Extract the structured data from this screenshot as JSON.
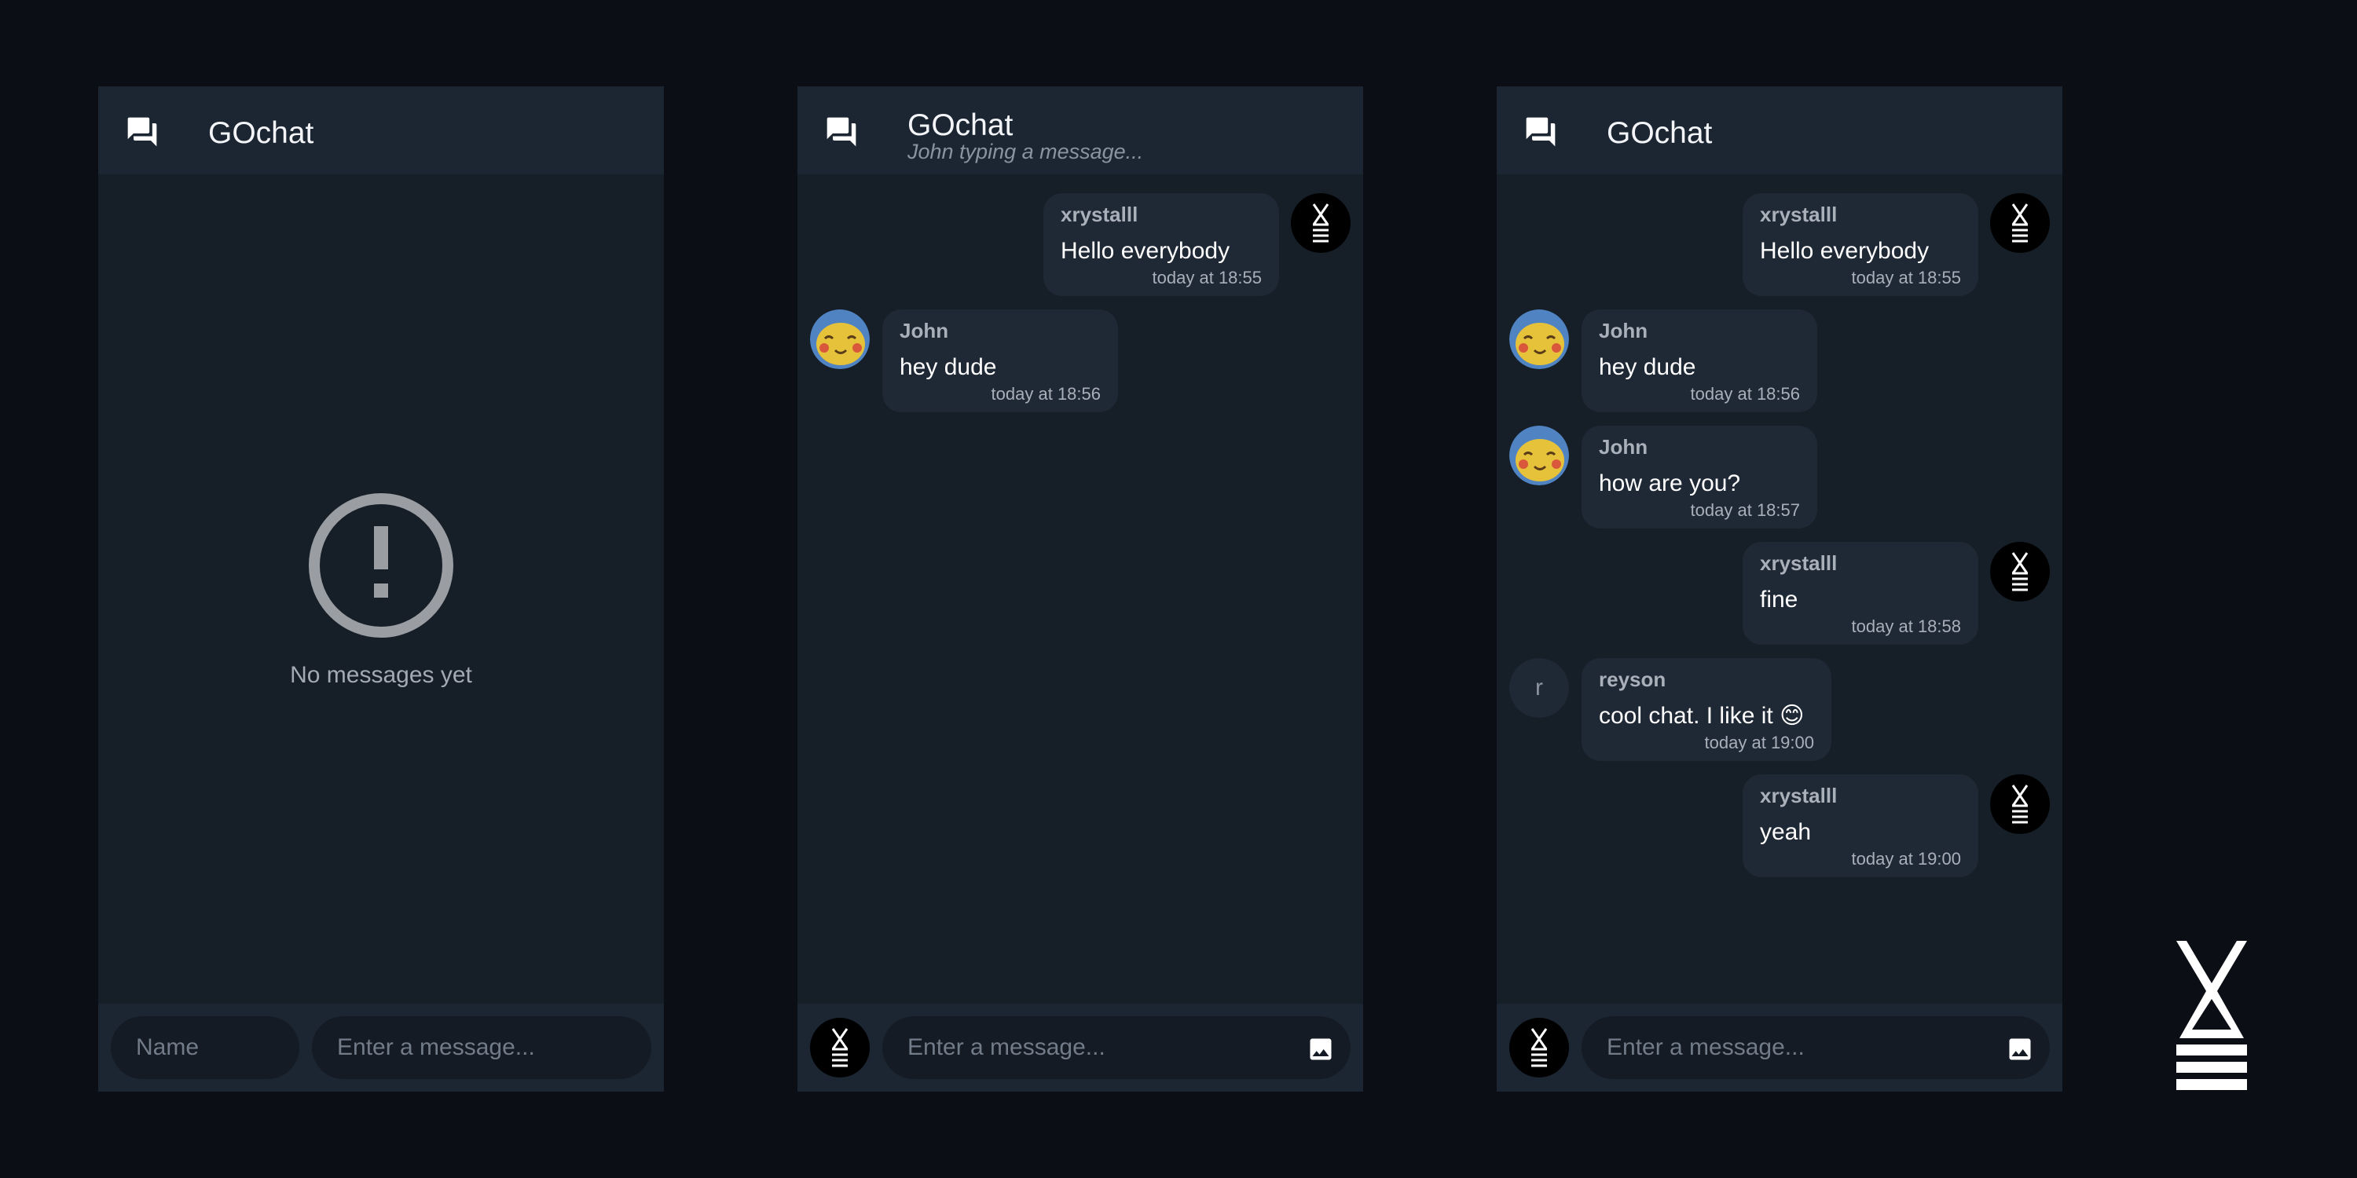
{
  "app": {
    "title": "GOchat"
  },
  "panel1": {
    "empty_text": "No messages yet",
    "name_placeholder": "Name",
    "message_placeholder": "Enter a message..."
  },
  "panel2": {
    "typing_status": "John typing a message...",
    "message_placeholder": "Enter a message...",
    "messages": [
      {
        "author": "xrystalll",
        "text": "Hello everybody",
        "time": "today at 18:55",
        "avatar": "x-logo-avatar",
        "side": "right"
      },
      {
        "author": "John",
        "text": "hey dude",
        "time": "today at 18:56",
        "avatar": "pikachu-avatar",
        "side": "left"
      }
    ]
  },
  "panel3": {
    "message_placeholder": "Enter a message...",
    "messages": [
      {
        "author": "xrystalll",
        "text": "Hello everybody",
        "time": "today at 18:55",
        "avatar": "x-logo-avatar",
        "side": "right"
      },
      {
        "author": "John",
        "text": "hey dude",
        "time": "today at 18:56",
        "avatar": "pikachu-avatar",
        "side": "left"
      },
      {
        "author": "John",
        "text": "how are you?",
        "time": "today at 18:57",
        "avatar": "pikachu-avatar",
        "side": "left"
      },
      {
        "author": "xrystalll",
        "text": "fine",
        "time": "today at 18:58",
        "avatar": "x-logo-avatar",
        "side": "right"
      },
      {
        "author": "reyson",
        "text": "cool chat. I like it 😊",
        "time": "today at 19:00",
        "avatar": "letter-avatar",
        "avatar_letter": "r",
        "side": "left"
      },
      {
        "author": "xrystalll",
        "text": "yeah",
        "time": "today at 19:00",
        "avatar": "x-logo-avatar",
        "side": "right"
      }
    ]
  },
  "icons": {
    "header": "forum-icon",
    "empty": "exclamation-circle-icon",
    "attach": "image-icon",
    "brand": "x-logo"
  },
  "colors": {
    "page_background": "#0b0f15",
    "panel_background": "#161e28",
    "header_background": "#1c2633",
    "bubble_background": "#1f2835",
    "input_background": "#141b24"
  }
}
